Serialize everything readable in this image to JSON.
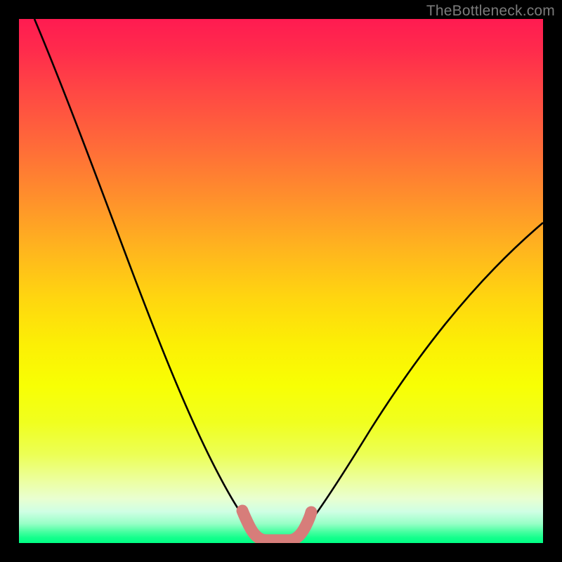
{
  "watermark": {
    "text": "TheBottleneck.com"
  },
  "colors": {
    "background": "#000000",
    "curve": "#000000",
    "marker": "#d77d7a",
    "gradient_top": "#ff1b51",
    "gradient_bottom": "#00ff85"
  },
  "chart_data": {
    "type": "line",
    "title": "",
    "xlabel": "",
    "ylabel": "",
    "xlim": [
      0,
      100
    ],
    "ylim": [
      0,
      100
    ],
    "grid": false,
    "legend": false,
    "series": [
      {
        "name": "bottleneck-curve",
        "x": [
          3,
          8,
          13,
          18,
          23,
          28,
          33,
          37,
          40,
          42,
          44,
          46,
          48,
          50,
          52,
          55,
          60,
          65,
          70,
          75,
          80,
          85,
          90,
          95,
          100
        ],
        "y": [
          100,
          89,
          78,
          67,
          56,
          46,
          35,
          25,
          17,
          11,
          6,
          3,
          1.2,
          1.0,
          1.2,
          4,
          12,
          20,
          28,
          35,
          41,
          47,
          52,
          57,
          61
        ]
      }
    ],
    "annotations": [
      {
        "name": "optimal-region-marker",
        "shape": "rounded-u",
        "x_range": [
          43.5,
          52.5
        ],
        "y_at_bottom": 1.0,
        "color": "#d77d7a"
      }
    ]
  }
}
